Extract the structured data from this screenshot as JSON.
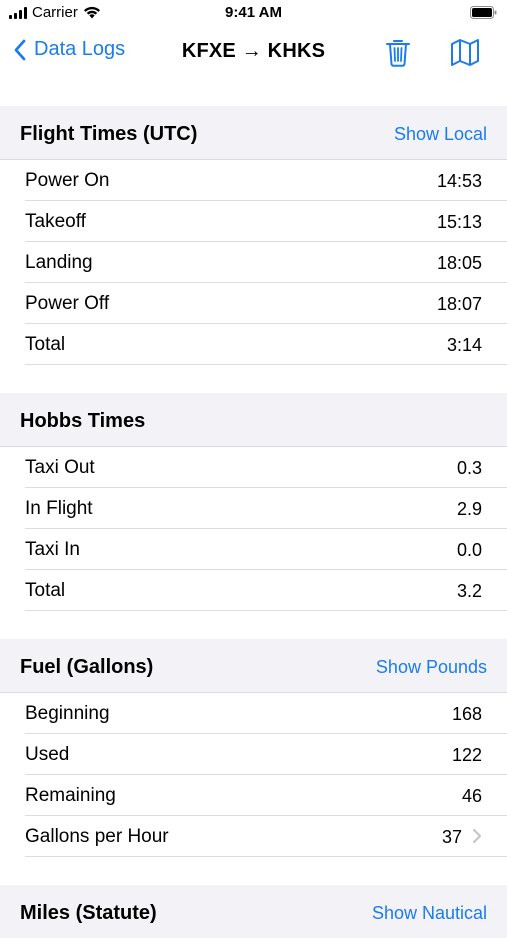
{
  "status_bar": {
    "carrier": "Carrier",
    "time": "9:41 AM"
  },
  "nav": {
    "back_label": "Data Logs",
    "title": "KFXE → KHKS"
  },
  "sections": [
    {
      "title": "Flight Times (UTC)",
      "action": "Show Local",
      "rows": [
        {
          "label": "Power On",
          "value": "14:53"
        },
        {
          "label": "Takeoff",
          "value": "15:13"
        },
        {
          "label": "Landing",
          "value": "18:05"
        },
        {
          "label": "Power Off",
          "value": "18:07"
        },
        {
          "label": "Total",
          "value": "3:14"
        }
      ]
    },
    {
      "title": "Hobbs Times",
      "action": "",
      "rows": [
        {
          "label": "Taxi Out",
          "value": "0.3"
        },
        {
          "label": "In Flight",
          "value": "2.9"
        },
        {
          "label": "Taxi In",
          "value": "0.0"
        },
        {
          "label": "Total",
          "value": "3.2"
        }
      ]
    },
    {
      "title": "Fuel (Gallons)",
      "action": "Show Pounds",
      "rows": [
        {
          "label": "Beginning",
          "value": "168"
        },
        {
          "label": "Used",
          "value": "122"
        },
        {
          "label": "Remaining",
          "value": "46"
        },
        {
          "label": "Gallons per Hour",
          "value": "37"
        }
      ]
    },
    {
      "title": "Miles (Statute)",
      "action": "Show Nautical",
      "rows": []
    }
  ],
  "colors": {
    "accent": "#1a7cf0",
    "section_bg": "#f2f2f7",
    "separator": "#dcdce0"
  }
}
